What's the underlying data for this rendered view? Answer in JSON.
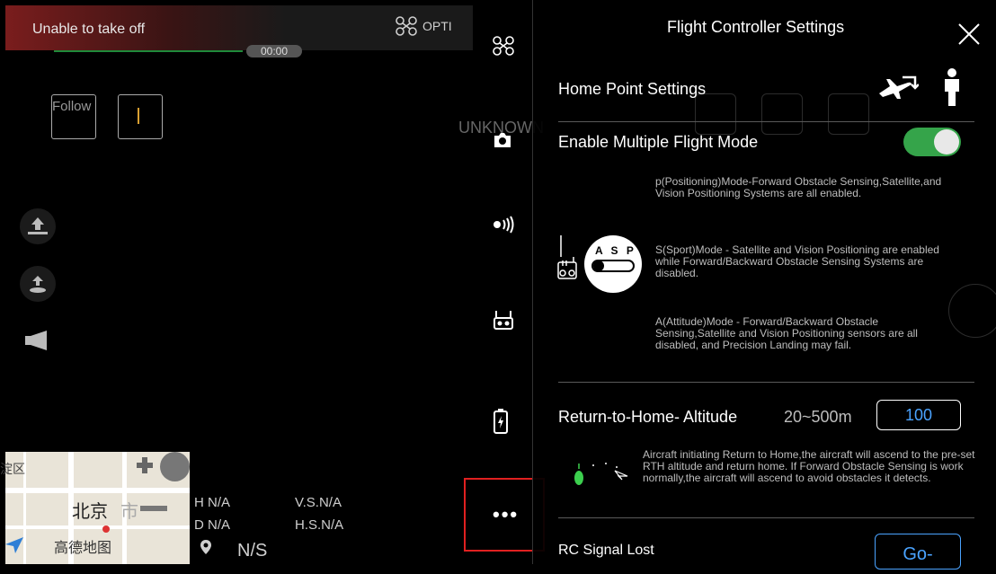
{
  "status": {
    "banner_text": "Unable to take off",
    "mode_label": "OPTI",
    "time": "00:00"
  },
  "left_controls": {
    "follow_label": "Follow",
    "takeoff_icon": "takeoff-icon",
    "rth_icon": "return-home-icon",
    "speaker_icon": "speaker-icon"
  },
  "map": {
    "district": "淀区",
    "city": "北京",
    "city_suffix": "市",
    "brand": "高德地图"
  },
  "telemetry": {
    "h": "H N/A",
    "d": "D N/A",
    "vs": "V.S.N/A",
    "hs": "H.S.N/A",
    "ns": "N/S"
  },
  "column": {
    "unknown_label": "UNKNOWN",
    "more_label": "•••",
    "icons": [
      "drone-icon",
      "camera-icon",
      "transmission-icon",
      "remote-controller-icon",
      "battery-icon",
      "more-icon"
    ]
  },
  "panel": {
    "title": "Flight Controller Settings",
    "home_point": "Home Point Settings",
    "multi_mode": "Enable Multiple Flight Mode",
    "multi_mode_enabled": true,
    "p_mode_desc": "p(Positioning)Mode-Forward Obstacle Sensing,Satellite,and Vision Positioning Systems are all enabled.",
    "s_mode_desc": "S(Sport)Mode - Satellite and Vision Positioning are enabled while Forward/Backward Obstacle Sensing Systems are disabled.",
    "a_mode_desc": "A(Attitude)Mode - Forward/Backward Obstacle Sensing,Satellite and Vision Positioning sensors are all disabled, and Precision Landing may fail.",
    "asp_label": "A S P",
    "rth_altitude_label": "Return-to-Home- Altitude",
    "rth_range": "20~500m",
    "rth_value": "100",
    "rth_desc": "Aircraft initiating Return to Home,the aircraft will ascend to the pre-set RTH altitude and return home. If Forward Obstacle Sensing is work normally,the aircraft will ascend to avoid obstacles it detects.",
    "rc_signal_lost": "RC Signal Lost",
    "rc_signal_action": "Go-"
  },
  "colors": {
    "accent": "#4aa3ff",
    "toggle_on": "#35a44a",
    "highlight": "#e02020",
    "banner": "#7a1d1d"
  }
}
